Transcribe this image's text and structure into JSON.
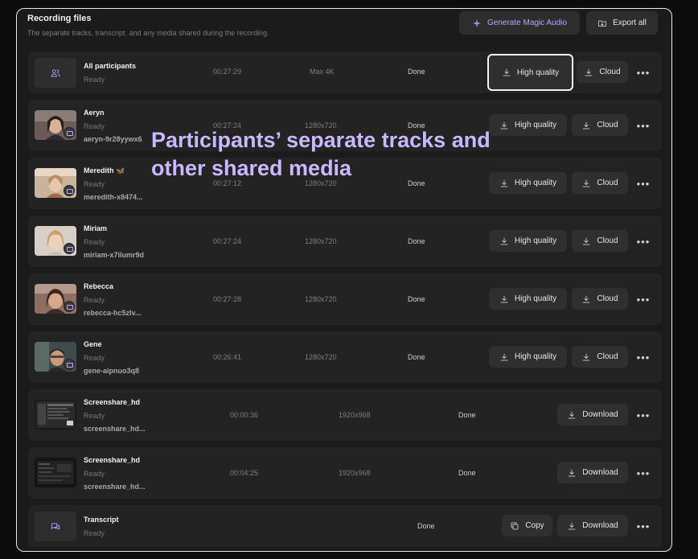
{
  "header": {
    "title": "Recording files",
    "subtitle": "The separate tracks, transcript, and any media shared during the recording.",
    "magic_label": "Generate Magic Audio",
    "export_label": "Export all"
  },
  "overlay": {
    "line1": "Participants’ separate tracks and",
    "line2": "other shared media"
  },
  "rows": [
    {
      "name": "All participants",
      "status": "Ready",
      "id": "",
      "duration": "00:27:29",
      "resolution": "Max 4K",
      "state": "Done",
      "buttons": [
        "High quality",
        "Cloud"
      ],
      "icon": "users-icon"
    },
    {
      "name": "Aeryn",
      "status": "Ready",
      "id": "aeryn-9r28yywx6",
      "duration": "00:27:24",
      "resolution": "1280x720",
      "state": "Done",
      "buttons": [
        "High quality",
        "Cloud"
      ]
    },
    {
      "name": "Meredith 🦋",
      "status": "Ready",
      "id": "meredith-x8474...",
      "duration": "00:27:12",
      "resolution": "1280x720",
      "state": "Done",
      "buttons": [
        "High quality",
        "Cloud"
      ]
    },
    {
      "name": "Miriam",
      "status": "Ready",
      "id": "miriam-x7ilumr9d",
      "duration": "00:27:24",
      "resolution": "1280x720",
      "state": "Done",
      "buttons": [
        "High quality",
        "Cloud"
      ]
    },
    {
      "name": "Rebecca",
      "status": "Ready",
      "id": "rebecca-hc5zlv...",
      "duration": "00:27:28",
      "resolution": "1280x720",
      "state": "Done",
      "buttons": [
        "High quality",
        "Cloud"
      ]
    },
    {
      "name": "Gene",
      "status": "Ready",
      "id": "gene-aipnuo3q8",
      "duration": "00:26:41",
      "resolution": "1280x720",
      "state": "Done",
      "buttons": [
        "High quality",
        "Cloud"
      ]
    },
    {
      "name": "Screenshare_hd",
      "status": "Ready",
      "id": "screenshare_hd...",
      "duration": "00:00:36",
      "resolution": "1920x968",
      "state": "Done",
      "buttons": [
        "Download"
      ]
    },
    {
      "name": "Screenshare_hd",
      "status": "Ready",
      "id": "screenshare_hd...",
      "duration": "00:04:25",
      "resolution": "1920x968",
      "state": "Done",
      "buttons": [
        "Download"
      ]
    },
    {
      "name": "Transcript",
      "status": "Ready",
      "id": "",
      "duration": "",
      "resolution": "",
      "state": "Done",
      "buttons": [
        "Copy",
        "Download"
      ],
      "icon": "transcript-icon"
    }
  ],
  "more_label": "•••",
  "colors": {
    "accent": "#b7a6ff",
    "panel": "#1b1b1b",
    "row": "#232323",
    "button": "#2f2f2f"
  }
}
